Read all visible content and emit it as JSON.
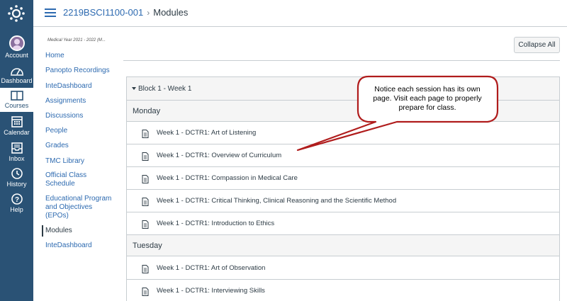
{
  "global_nav": {
    "items": [
      {
        "label": "Account",
        "icon": "avatar"
      },
      {
        "label": "Dashboard",
        "icon": "dashboard-icon"
      },
      {
        "label": "Courses",
        "icon": "courses-icon"
      },
      {
        "label": "Calendar",
        "icon": "calendar-icon"
      },
      {
        "label": "Inbox",
        "icon": "inbox-icon"
      },
      {
        "label": "History",
        "icon": "history-icon"
      },
      {
        "label": "Help",
        "icon": "help-icon"
      }
    ],
    "active": "Courses",
    "colors": {
      "bg": "#2a5275",
      "active_bg": "#ffffff"
    }
  },
  "header": {
    "course_link": "2219BSCI1100-001",
    "separator": "›",
    "current_page": "Modules"
  },
  "course_nav": {
    "subtitle": "Medical Year 2021 - 2022 (M...",
    "items": [
      {
        "label": "Home"
      },
      {
        "label": "Panopto Recordings"
      },
      {
        "label": "InteDashboard"
      },
      {
        "label": "Assignments"
      },
      {
        "label": "Discussions"
      },
      {
        "label": "People"
      },
      {
        "label": "Grades"
      },
      {
        "label": "TMC Library"
      },
      {
        "label": "Official Class Schedule"
      },
      {
        "label": "Educational Program and Objectives (EPOs)"
      },
      {
        "label": "Modules"
      },
      {
        "label": "InteDashboard"
      }
    ],
    "active": "Modules"
  },
  "toolbar": {
    "collapse_all": "Collapse All"
  },
  "module": {
    "title": "Block 1 - Week 1",
    "sections": [
      {
        "day": "Monday",
        "items": [
          "Week 1 - DCTR1: Art of Listening",
          "Week 1 - DCTR1: Overview of Curriculum",
          "Week 1 - DCTR1: Compassion in Medical Care",
          "Week 1 - DCTR1: Critical Thinking, Clinical Reasoning and the Scientific Method",
          "Week 1 - DCTR1: Introduction to Ethics"
        ]
      },
      {
        "day": "Tuesday",
        "items": [
          "Week 1 - DCTR1: Art of Observation",
          "Week 1 - DCTR1: Interviewing Skills"
        ]
      }
    ]
  },
  "callout": {
    "text": "Notice each session has its own page. Visit each page to properly prepare for class.",
    "border_color": "#b01c1c"
  }
}
